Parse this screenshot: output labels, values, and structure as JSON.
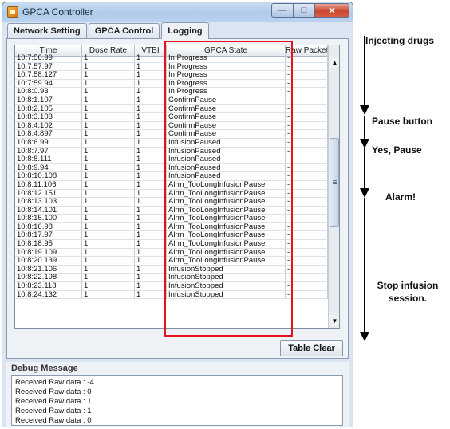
{
  "window": {
    "title": "GPCA Controller",
    "icon": "java-cup-icon"
  },
  "tabs": [
    {
      "label": "Network Setting",
      "active": false
    },
    {
      "label": "GPCA Control",
      "active": false
    },
    {
      "label": "Logging",
      "active": true
    }
  ],
  "table": {
    "columns": [
      "Time",
      "Dose Rate",
      "VTBI",
      "GPCA State",
      "Raw Packet"
    ],
    "rows": [
      [
        "10:7:56.99",
        "1",
        "1",
        "In Progress",
        "-"
      ],
      [
        "10:7:57.97",
        "1",
        "1",
        "In Progress",
        "-"
      ],
      [
        "10:7:58.127",
        "1",
        "1",
        "In Progress",
        "-"
      ],
      [
        "10:7:59.94",
        "1",
        "1",
        "In Progress",
        "-"
      ],
      [
        "10:8:0.93",
        "1",
        "1",
        "In Progress",
        "-"
      ],
      [
        "10:8:1.107",
        "1",
        "1",
        "ConfirmPause",
        "-"
      ],
      [
        "10:8:2.105",
        "1",
        "1",
        "ConfirmPause",
        "-"
      ],
      [
        "10:8:3.103",
        "1",
        "1",
        "ConfirmPause",
        "-"
      ],
      [
        "10:8:4.102",
        "1",
        "1",
        "ConfirmPause",
        "-"
      ],
      [
        "10:8:4.897",
        "1",
        "1",
        "ConfirmPause",
        "-"
      ],
      [
        "10:8:6.99",
        "1",
        "1",
        "InfusionPaused",
        "-"
      ],
      [
        "10:8:7.97",
        "1",
        "1",
        "InfusionPaused",
        "-"
      ],
      [
        "10:8:8.111",
        "1",
        "1",
        "InfusionPaused",
        "-"
      ],
      [
        "10:8:9.94",
        "1",
        "1",
        "InfusionPaused",
        "-"
      ],
      [
        "10:8:10.108",
        "1",
        "1",
        "InfusionPaused",
        "-"
      ],
      [
        "10:8:11.106",
        "1",
        "1",
        "Alrm_TooLongInfusionPause",
        "-"
      ],
      [
        "10:8:12.151",
        "1",
        "1",
        "Alrm_TooLongInfusionPause",
        "-"
      ],
      [
        "10:8:13.103",
        "1",
        "1",
        "Alrm_TooLongInfusionPause",
        "-"
      ],
      [
        "10:8:14.101",
        "1",
        "1",
        "Alrm_TooLongInfusionPause",
        "-"
      ],
      [
        "10:8:15.100",
        "1",
        "1",
        "Alrm_TooLongInfusionPause",
        "-"
      ],
      [
        "10:8:16.98",
        "1",
        "1",
        "Alrm_TooLongInfusionPause",
        "-"
      ],
      [
        "10:8:17.97",
        "1",
        "1",
        "Alrm_TooLongInfusionPause",
        "-"
      ],
      [
        "10:8:18.95",
        "1",
        "1",
        "Alrm_TooLongInfusionPause",
        "-"
      ],
      [
        "10:8:19.109",
        "1",
        "1",
        "Alrm_TooLongInfusionPause",
        "-"
      ],
      [
        "10:8:20.139",
        "1",
        "1",
        "Alrm_TooLongInfusionPause",
        "-"
      ],
      [
        "10:8:21.106",
        "1",
        "1",
        "InfusionStopped",
        "-"
      ],
      [
        "10:8:22.198",
        "1",
        "1",
        "InfusionStopped",
        "-"
      ],
      [
        "10:8:23.118",
        "1",
        "1",
        "InfusionStopped",
        "-"
      ],
      [
        "10:8:24.132",
        "1",
        "1",
        "InfusionStopped",
        "-"
      ]
    ]
  },
  "buttons": {
    "table_clear": "Table Clear"
  },
  "debug": {
    "title": "Debug Message",
    "lines": [
      "Received Raw data : -4",
      "Received Raw data : 0",
      "Received Raw data : 1",
      "Received Raw data : 1",
      "Received Raw data : 0"
    ]
  },
  "annotations": {
    "injecting": "Injecting drugs",
    "pause": "Pause button",
    "yes_pause": "Yes, Pause",
    "alarm": "Alarm!",
    "stop": "Stop infusion session."
  },
  "colors": {
    "highlight": "#e8131a",
    "window_frame": "#aecbea",
    "close_button": "#c9462c"
  }
}
